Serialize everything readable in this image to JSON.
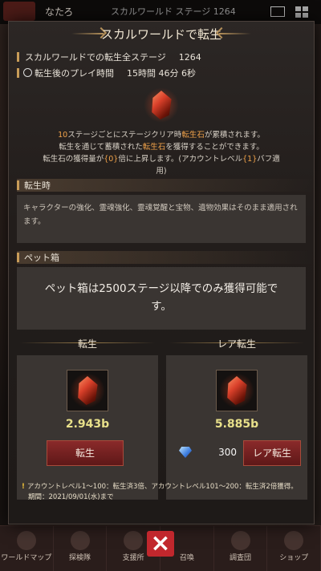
{
  "background": {
    "player_name": "なたろ",
    "stage_info": "スカルワールド ステージ 1264",
    "nav": [
      "ワールドマップ",
      "探検隊",
      "支援所",
      "召喚",
      "調査団",
      "ショップ"
    ]
  },
  "modal": {
    "title": "スカルワールドで転生",
    "all_stages_label": "スカルワールドでの転生全ステージ",
    "all_stages_value": "1264",
    "playtime_label": "転生後のプレイ時間",
    "playtime_value": "15時間 46分 6秒",
    "desc": {
      "line1_a": "10",
      "line1_b": "ステージごとにステージクリア時",
      "line1_c": "転生石",
      "line1_d": "が累積されます。",
      "line2_a": "転生を通じて蓄積された",
      "line2_b": "転生石",
      "line2_c": "を獲得することができます。",
      "line3": "転生石の獲得量が",
      "line3_b": "{0}",
      "line3_c": "倍に上昇します。(アカウントレベル",
      "line3_d": "{1}",
      "line3_e": "バフ適",
      "line4": "用)"
    },
    "rebirth_section_title": "転生時",
    "rebirth_section_text": "キャラクターの強化、霊魂強化、霊魂覚醒と宝物、遺物効果はそのまま適用されます。",
    "pet_section_title": "ペット箱",
    "pet_text_line1": "ペット箱は2500ステージ以降でのみ獲得可能で",
    "pet_text_line2": "す。",
    "left_panel": {
      "title": "転生",
      "amount": "2.943b",
      "button": "転生"
    },
    "right_panel": {
      "title": "レア転生",
      "amount": "5.885b",
      "cost": "300",
      "button": "レア転生"
    },
    "note_line1": "アカウントレベル1～100：転生済3倍、アカウントレベル101～200：転生済2倍獲得。",
    "note_line2": "期間：2021/09/01(水)まで",
    "note_icon": "!"
  },
  "colors": {
    "accent": "#c89c58",
    "highlight": "#f0a24a",
    "button": "#7a2424",
    "close": "#c1272d"
  }
}
